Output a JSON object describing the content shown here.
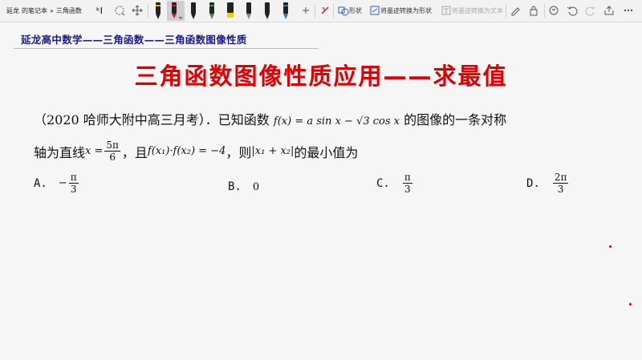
{
  "toolbar": {
    "breadcrumb": [
      "延龙",
      "的笔记本",
      "»",
      "三角函数"
    ],
    "shape_label": "形状",
    "ink_to_shape_label": "将墨迹转换为形状",
    "ink_to_text_label": "将墨迹转换为文本",
    "icons": [
      "lasso-select-icon",
      "eraser-select-icon",
      "pan-icon",
      "black-pen-icon",
      "red-pen-icon",
      "black-pen-icon",
      "green-pen-icon",
      "yellow-highlighter-icon",
      "gray-pen-icon",
      "blue-pen-icon",
      "add-pen-icon",
      "ruler-icon",
      "shape-icon",
      "ink-to-shape-icon",
      "ink-to-text-icon",
      "pencil-icon",
      "lock-icon",
      "undo-icon",
      "redo-icon",
      "share-icon",
      "more-icon"
    ],
    "colors": {
      "red_pen": "#d81818",
      "green_pen": "#2a9d2a",
      "yellow_pen": "#f2d000",
      "blue_pen": "#2c74d8"
    }
  },
  "note": {
    "breadcrumb": "延龙高中数学——三角函数——三角函数图像性质",
    "title": "三角函数图像性质应用——求最值",
    "title_color": "#e00000",
    "question": {
      "part1": "（2020 哈师大附中高三月考）．已知函数",
      "func": "f(x) = a sin x − √3 cos x",
      "part2": "的图像的一条对称",
      "line2_prefix": "轴为直线",
      "axis_lhs": "x =",
      "axis_num": "5π",
      "axis_den": "6",
      "part3": "，且",
      "condition": "f(x₁)·f(x₂) = −4",
      "part4": "，则",
      "abs_expr": "|x₁ + x₂|",
      "part5": "的最小值为"
    },
    "options": [
      {
        "letter": "A.",
        "sign": "−",
        "num": "π",
        "den": "3"
      },
      {
        "letter": "B.",
        "value": "0"
      },
      {
        "letter": "C.",
        "num": "π",
        "den": "3"
      },
      {
        "letter": "D.",
        "num": "2π",
        "den": "3"
      }
    ]
  }
}
